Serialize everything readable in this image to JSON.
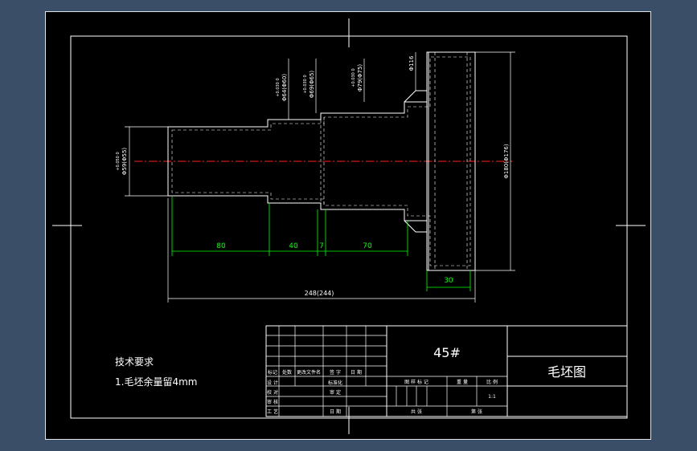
{
  "drawing": {
    "dimensions": {
      "d1": "Φ59(Φ55)",
      "d1_tol": "+0.050 0",
      "d2": "Φ64(Φ60)",
      "d2_tol": "+0.030 0",
      "d3": "Φ69(Φ65)",
      "d3_tol": "+0.030 0",
      "d4": "Φ79(Φ75)",
      "d4_tol": "+0.030 0",
      "d5": "Φ116",
      "d6": "Φ180(Φ176)",
      "len80": "80",
      "len40": "40",
      "len7": "7",
      "len70": "70",
      "len30": "30",
      "total": "248(244)"
    },
    "tech_requirements": {
      "title": "技术要求",
      "item1": "1.毛坯余量留4mm"
    },
    "title_block": {
      "material": "45#",
      "drawing_name": "毛坯图",
      "h_mark": "标记",
      "h_count": "处数",
      "h_file": "更改文件名",
      "h_sign": "签 字",
      "h_date": "日 期",
      "r_design": "设 计",
      "r_check": "校 对",
      "r_review": "审 核",
      "r_process": "工 艺",
      "r_std": "标准化",
      "r_approve": "审 定",
      "r_date": "日 期",
      "h_stage": "图 样 标 记",
      "h_weight": "重 量",
      "h_scale": "比 例",
      "scale_value": "1:1",
      "sheets_total": "共 张",
      "sheet_no": "第 张"
    }
  }
}
